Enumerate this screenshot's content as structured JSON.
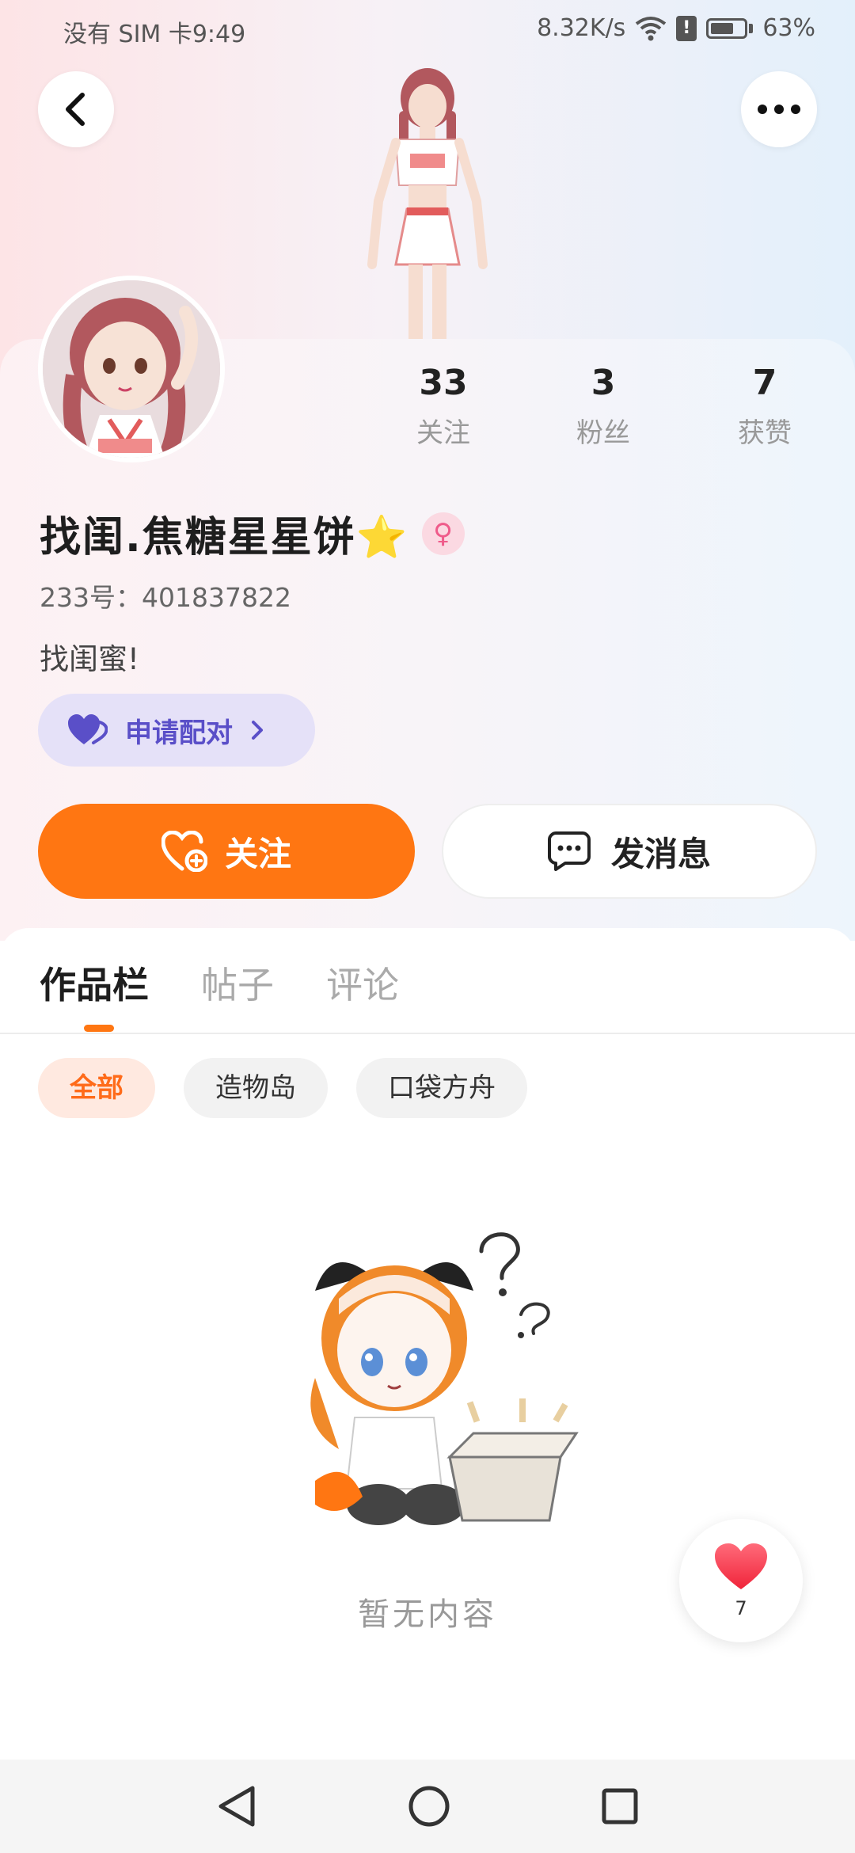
{
  "status_bar": {
    "carrier_time": "没有 SIM 卡9:49",
    "net_speed": "8.32K/s",
    "battery": "63%"
  },
  "header": {
    "back_icon": "chevron-left-icon",
    "more_icon": "more-dots-icon"
  },
  "profile": {
    "name": "找闺.焦糖星星饼⭐",
    "gender_icon": "female-icon",
    "uid": "233号：401837822",
    "bio": "找闺蜜!",
    "stats": [
      {
        "value": "33",
        "label": "关注"
      },
      {
        "value": "3",
        "label": "粉丝"
      },
      {
        "value": "7",
        "label": "获赞"
      }
    ]
  },
  "actions": {
    "pair_label": "申请配对",
    "follow_label": "关注",
    "message_label": "发消息"
  },
  "tabs": [
    "作品栏",
    "帖子",
    "评论"
  ],
  "filters": [
    "全部",
    "造物岛",
    "口袋方舟"
  ],
  "empty_state": {
    "text": "暂无内容"
  },
  "like_float": {
    "count": "7"
  },
  "colors": {
    "accent": "#ff7612",
    "pair_bg": "#e5e1f8",
    "pair_text": "#5a4fc8"
  }
}
